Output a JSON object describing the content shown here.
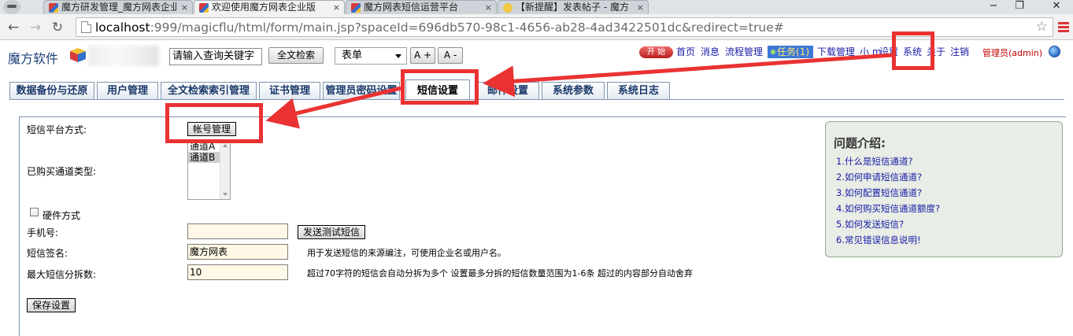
{
  "browser": {
    "tabs": [
      {
        "title": "魔方研发管理_魔方网表企业"
      },
      {
        "title": "欢迎使用魔方网表企业版"
      },
      {
        "title": "魔方网表短信运营平台"
      },
      {
        "title": "【新提醒】发表帖子 - 魔方"
      }
    ],
    "tab_close": "×",
    "window_controls": {
      "minimize": "−",
      "maximize": "❐",
      "close": "✕"
    },
    "nav": {
      "back": "←",
      "forward": "→",
      "reload": "↻"
    },
    "url_host": "localhost",
    "url_rest": ":999/magicflu/html/form/main.jsp?spaceId=696db570-98c1-4656-ab28-4ad3422501dc&redirect=true#",
    "bookmark_star": "☆"
  },
  "header": {
    "logo_text": "魔方软件",
    "search_placeholder": "请输入查询关键字",
    "fulltext_button": "全文检索",
    "form_select": "表单",
    "font_larger": "A +",
    "font_smaller": "A -",
    "start_button": "开 始",
    "nav_links": [
      {
        "label": "首页"
      },
      {
        "label": "消息"
      },
      {
        "label": "流程管理"
      }
    ],
    "task_badge": "任务(1)",
    "nav_links2": [
      {
        "label": "下载管理"
      },
      {
        "label": "小 m"
      },
      {
        "label": "设置"
      },
      {
        "label": "系统"
      },
      {
        "label": "关于"
      },
      {
        "label": "注销"
      }
    ],
    "admin_label": "管理员(admin)"
  },
  "main_tabs": [
    {
      "label": "数据备份与还原"
    },
    {
      "label": "用户管理"
    },
    {
      "label": "全文检索索引管理"
    },
    {
      "label": "证书管理"
    },
    {
      "label": "管理员密码设置"
    },
    {
      "label": "短信设置"
    },
    {
      "label": "邮件设置"
    },
    {
      "label": "系统参数"
    },
    {
      "label": "系统日志"
    }
  ],
  "active_tab_index": 5,
  "form": {
    "platform_label": "短信平台方式:",
    "account_button": "帐号管理",
    "channel_label": "已购买通道类型:",
    "channels": [
      "通道A",
      "通道B"
    ],
    "selected_channel": "通道B",
    "hardware_label": "硬件方式",
    "hardware_checked": false,
    "phone_label": "手机号:",
    "phone_value": "",
    "send_test_button": "发送测试短信",
    "signature_label": "短信签名:",
    "signature_value": "魔方网表",
    "signature_hint": "用于发送短信的来源编注，可使用企业名或用户名。",
    "split_label": "最大短信分拆数:",
    "split_value": "10",
    "split_hint": "超过70字符的短信会自动分拆为多个 设置最多分拆的短信数量范围为1-6条 超过的内容部分自动舍弃",
    "save_button": "保存设置"
  },
  "help": {
    "title": "问题介绍:",
    "items": [
      "1.什么是短信通道?",
      "2.如何申请短信通道?",
      "3.如何配置短信通道?",
      "4.如何购买短信通道额度?",
      "5.如何发送短信?",
      "6.常见错误信息说明!"
    ]
  },
  "colors": {
    "annotation": "#ea3232",
    "link": "#1a1aa6",
    "admin": "#c00000",
    "field_bg": "#fff8e6"
  }
}
